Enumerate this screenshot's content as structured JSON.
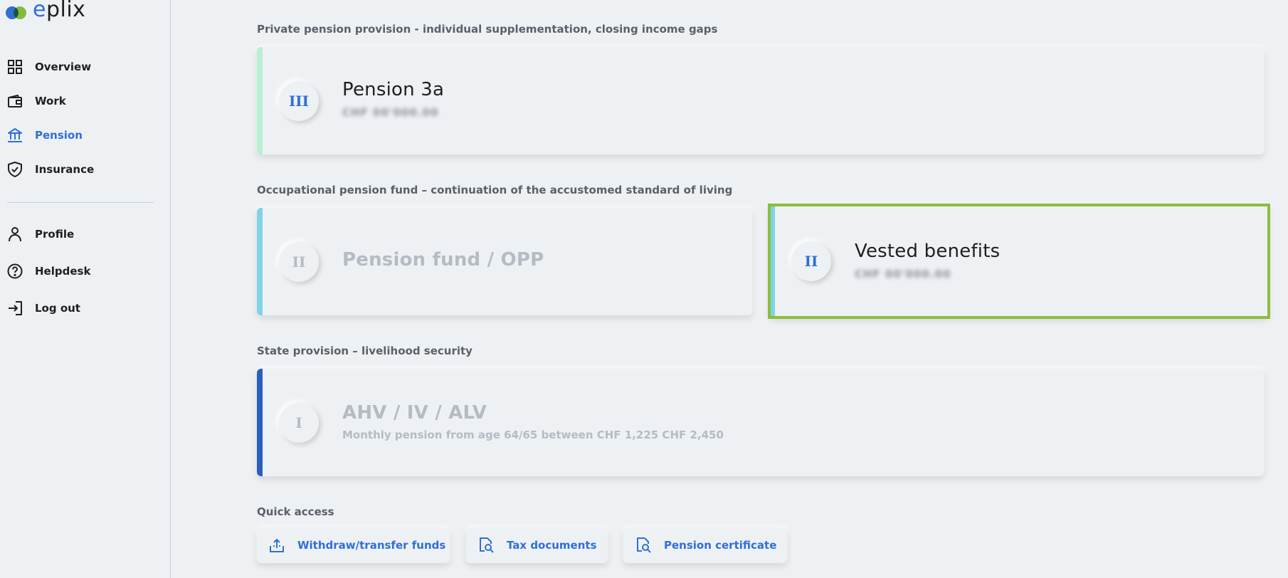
{
  "brand": {
    "logo_e": "e",
    "logo_rest": "plix",
    "blue": "#2f6fd6",
    "green": "#8cc63f"
  },
  "nav": {
    "items": [
      {
        "label": "Overview",
        "icon": "grid-icon"
      },
      {
        "label": "Work",
        "icon": "wallet-icon"
      },
      {
        "label": "Pension",
        "icon": "bank-icon",
        "active": true
      },
      {
        "label": "Insurance",
        "icon": "shield-check-icon"
      }
    ],
    "secondary": [
      {
        "label": "Profile",
        "icon": "user-icon"
      },
      {
        "label": "Helpdesk",
        "icon": "help-circle-icon"
      },
      {
        "label": "Log out",
        "icon": "logout-icon"
      }
    ]
  },
  "sections": {
    "private": "Private pension provision - individual supplementation, closing income gaps",
    "occupational": "Occupational pension fund – continuation of the accustomed standard of living",
    "state": "State provision – livelihood security",
    "quick": "Quick access"
  },
  "cards": {
    "pension3a": {
      "badge": "III",
      "title": "Pension 3a",
      "subtitle": "CHF 00'000.00",
      "stripe_color": "#b8f0d4"
    },
    "pension_fund": {
      "badge": "II",
      "title": "Pension fund / OPP",
      "stripe_color": "#7fd3e6"
    },
    "vested": {
      "badge": "II",
      "title": "Vested benefits",
      "subtitle": "CHF 00'000.00",
      "stripe_color": "#7fd3e6"
    },
    "ahv": {
      "badge": "I",
      "title": "AHV / IV / ALV",
      "subtitle": "Monthly pension from age 64/65 between CHF 1,225 CHF 2,450",
      "stripe_color": "#2a5fbf"
    }
  },
  "quick_access": [
    {
      "label": "Withdraw/transfer funds",
      "icon": "upload-tray-icon"
    },
    {
      "label": "Tax documents",
      "icon": "document-search-icon"
    },
    {
      "label": "Pension certificate",
      "icon": "document-search-icon"
    }
  ]
}
